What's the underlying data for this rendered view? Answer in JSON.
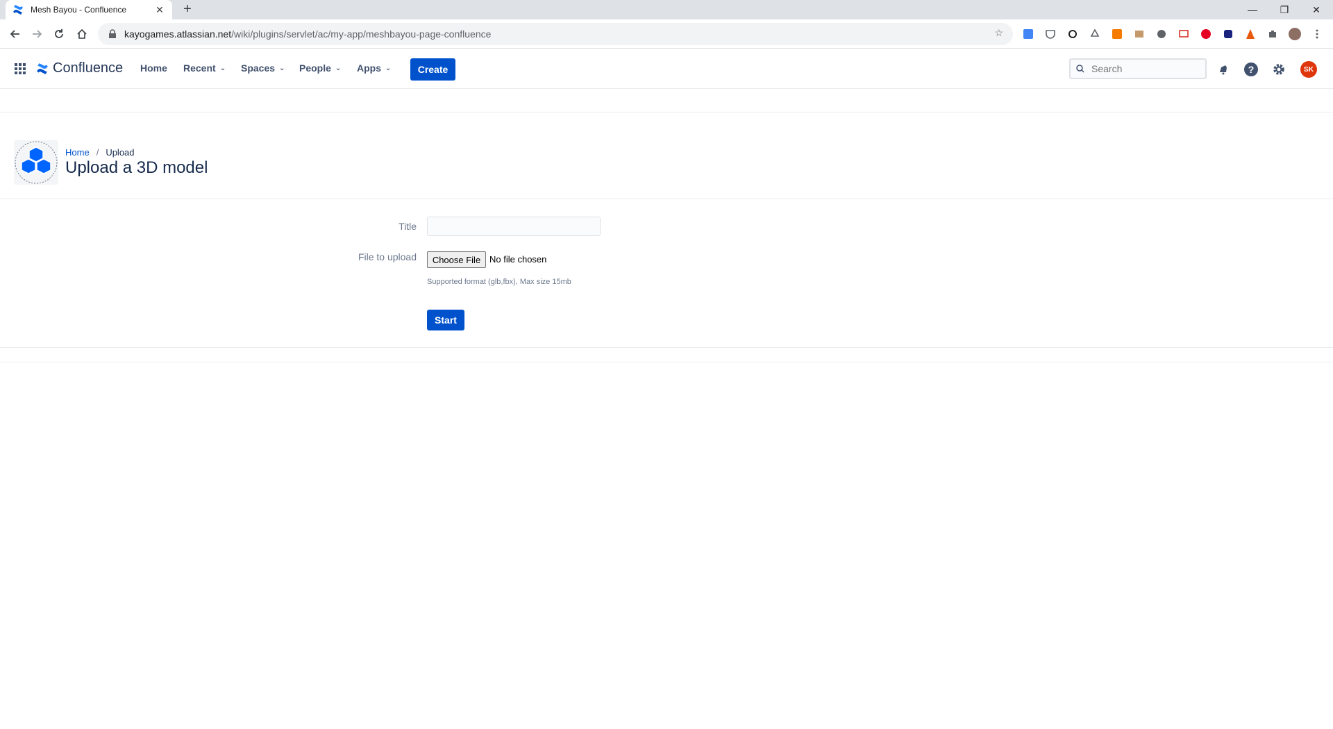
{
  "browser": {
    "tab_title": "Mesh Bayou - Confluence",
    "new_tab": "+",
    "url_domain": "kayogames.atlassian.net",
    "url_path": "/wiki/plugins/servlet/ac/my-app/meshbayou-page-confluence"
  },
  "header": {
    "product_name": "Confluence",
    "nav": [
      {
        "label": "Home"
      },
      {
        "label": "Recent"
      },
      {
        "label": "Spaces"
      },
      {
        "label": "People"
      },
      {
        "label": "Apps"
      }
    ],
    "create_label": "Create",
    "search_placeholder": "Search",
    "avatar_initials": "SK"
  },
  "page": {
    "breadcrumb": {
      "home": "Home",
      "separator": "/",
      "current": "Upload"
    },
    "title": "Upload a 3D model"
  },
  "form": {
    "title_label": "Title",
    "title_value": "",
    "file_label": "File to upload",
    "choose_file_label": "Choose File",
    "file_status": "No file chosen",
    "hint": "Supported format (glb,fbx), Max size 15mb",
    "start_label": "Start"
  },
  "colors": {
    "primary": "#0052cc",
    "avatar": "#de350b"
  }
}
